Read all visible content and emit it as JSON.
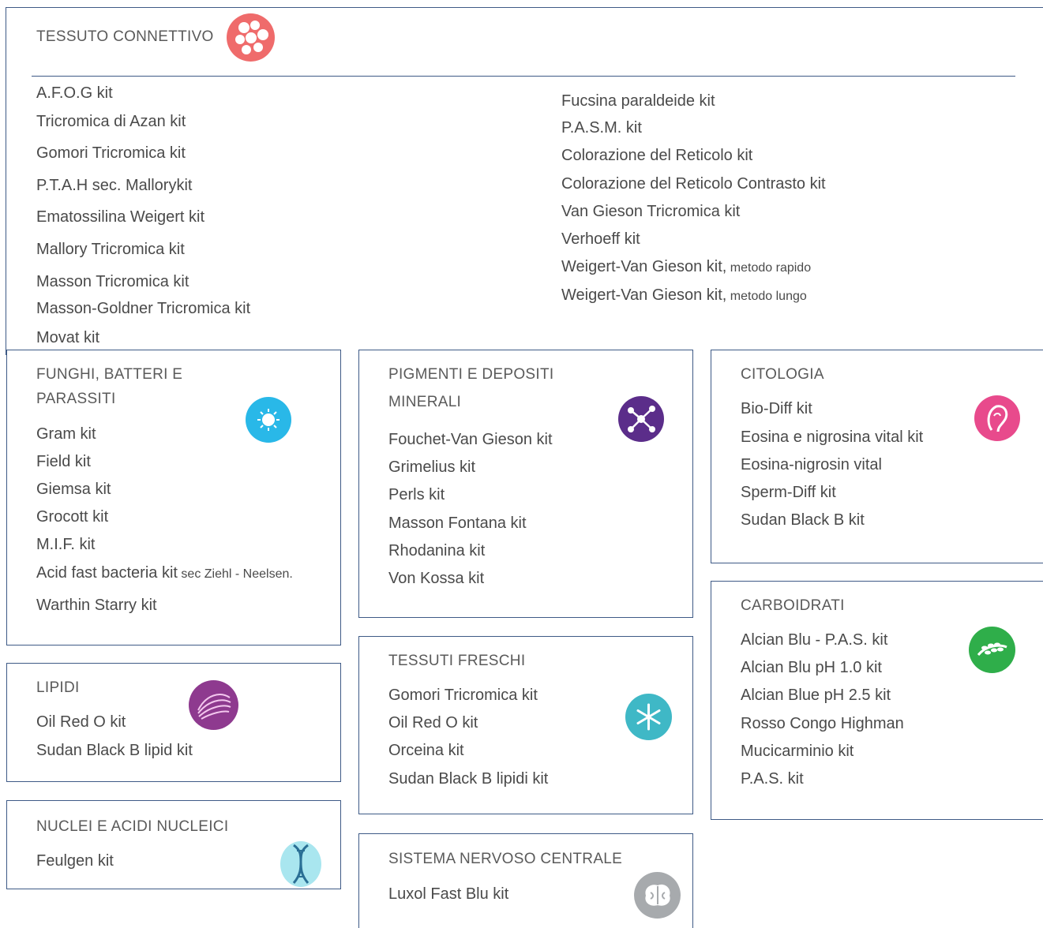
{
  "connettivo": {
    "title": "TESSUTO CONNETTIVO",
    "icon": "cells-icon",
    "color": "#ef6b6b",
    "left_items": [
      "A.F.O.G kit",
      "Tricromica di Azan kit",
      "Gomori Tricromica kit",
      "P.T.A.H sec. Mallorykit",
      "Ematossilina Weigert kit",
      "Mallory Tricromica kit",
      "Masson Tricromica kit",
      "Masson-Goldner Tricromica kit",
      "Movat kit"
    ],
    "right_items": [
      "Fucsina paraldeide kit",
      "P.A.S.M. kit",
      "Colorazione del Reticolo kit",
      "Colorazione del Reticolo Contrasto kit",
      "Van Gieson Tricromica kit",
      "Verhoeff kit"
    ],
    "right_extra": [
      {
        "main": "Weigert-Van Gieson kit,",
        "note": " metodo rapido"
      },
      {
        "main": "Weigert-Van Gieson kit,",
        "note": " metodo lungo"
      }
    ]
  },
  "funghi": {
    "title_line1": "FUNGHI, BATTERI E",
    "title_line2": "PARASSITI",
    "icon": "bacteria-icon",
    "color": "#29b8e8",
    "items": [
      "Gram kit",
      "Field kit",
      "Giemsa kit",
      "Grocott kit",
      "M.I.F. kit"
    ],
    "acid_main": "Acid fast bacteria kit",
    "acid_note": " sec Ziehl - Neelsen.",
    "last_item": "Warthin Starry kit"
  },
  "lipidi": {
    "title": "LIPIDI",
    "icon": "lipid-icon",
    "color": "#8e3a8f",
    "items": [
      "Oil Red O kit",
      "Sudan Black B lipid kit"
    ]
  },
  "nuclei": {
    "title": "NUCLEI E ACIDI NUCLEICI",
    "icon": "dna-icon",
    "color": "#a9e6ef",
    "items": [
      "Feulgen kit"
    ]
  },
  "pigmenti": {
    "title_line1": "PIGMENTI E DEPOSITI",
    "title_line2": "MINERALI",
    "icon": "molecule-icon",
    "color": "#5b2d8a",
    "items": [
      "Fouchet-Van Gieson kit",
      "Grimelius kit",
      "Perls kit",
      "Masson Fontana kit",
      "Rhodanina kit",
      "Von Kossa kit"
    ]
  },
  "freschi": {
    "title": "TESSUTI FRESCHI",
    "icon": "snowflake-icon",
    "color": "#3fb8c6",
    "items": [
      "Gomori Tricromica kit",
      "Oil Red O kit",
      "Orceina kit",
      "Sudan Black B lipidi kit"
    ]
  },
  "snc": {
    "title": "SISTEMA NERVOSO CENTRALE",
    "icon": "brain-icon",
    "color": "#a7aaad",
    "items": [
      "Luxol Fast Blu kit"
    ]
  },
  "citologia": {
    "title": "CITOLOGIA",
    "icon": "cell-face-icon",
    "color": "#e84a8c",
    "items": [
      "Bio-Diff kit",
      "Eosina e nigrosina vital kit",
      "Eosina-nigrosin vital",
      "Sperm-Diff kit",
      "Sudan Black B kit"
    ]
  },
  "carboidrati": {
    "title": "CARBOIDRATI",
    "icon": "wheat-icon",
    "color": "#2fae4a",
    "items": [
      "Alcian Blu - P.A.S. kit",
      "Alcian Blu pH 1.0 kit",
      "Alcian Blue pH 2.5 kit",
      "Rosso Congo Highman",
      "Mucicarminio kit",
      "P.A.S. kit"
    ]
  }
}
